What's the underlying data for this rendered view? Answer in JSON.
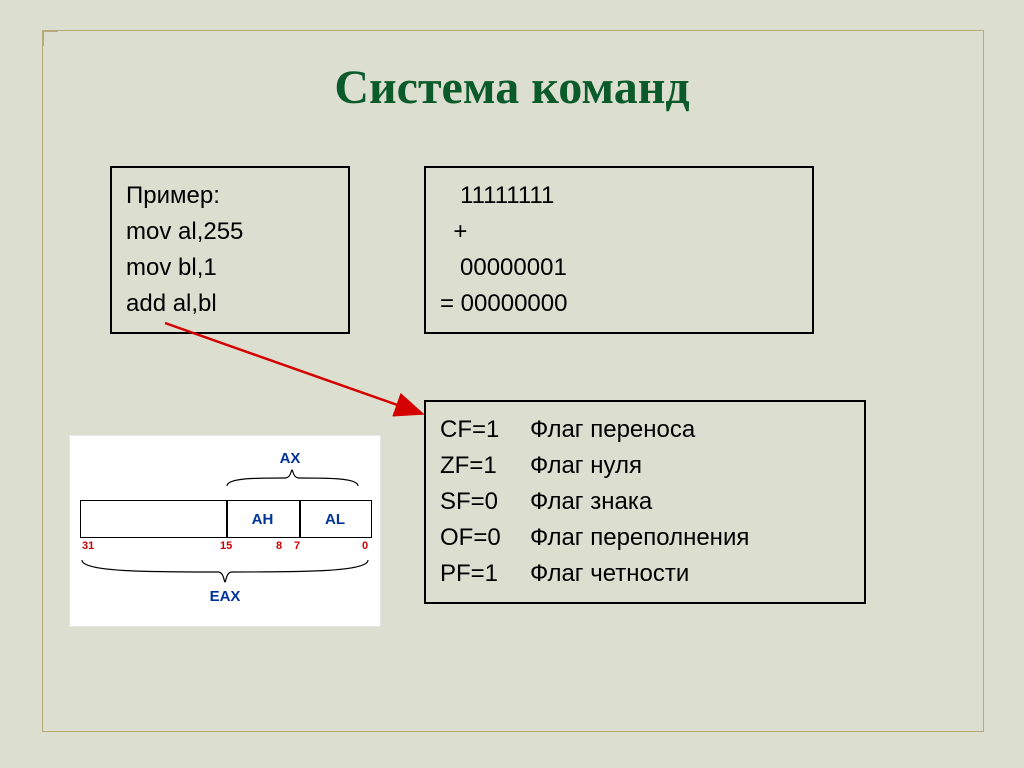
{
  "title": "Система команд",
  "example": {
    "label": "Пример:",
    "lines": [
      "mov al,255",
      "mov bl,1",
      "add al,bl"
    ]
  },
  "calc": {
    "a": "   11111111",
    "op": "  +",
    "b": "   00000001",
    "eq": "= 00000000"
  },
  "flags": [
    {
      "eq": "CF=1",
      "desc": "Флаг переноса"
    },
    {
      "eq": "ZF=1",
      "desc": "Флаг нуля"
    },
    {
      "eq": "SF=0",
      "desc": "Флаг знака"
    },
    {
      "eq": "OF=0",
      "desc": "Флаг переполнения"
    },
    {
      "eq": "PF=1",
      "desc": "Флаг четности"
    }
  ],
  "register": {
    "ax": "AX",
    "ah": "AH",
    "al": "AL",
    "eax": "EAX",
    "bits": {
      "b31": "31",
      "b15": "15",
      "b8": "8",
      "b7": "7",
      "b0": "0"
    }
  }
}
